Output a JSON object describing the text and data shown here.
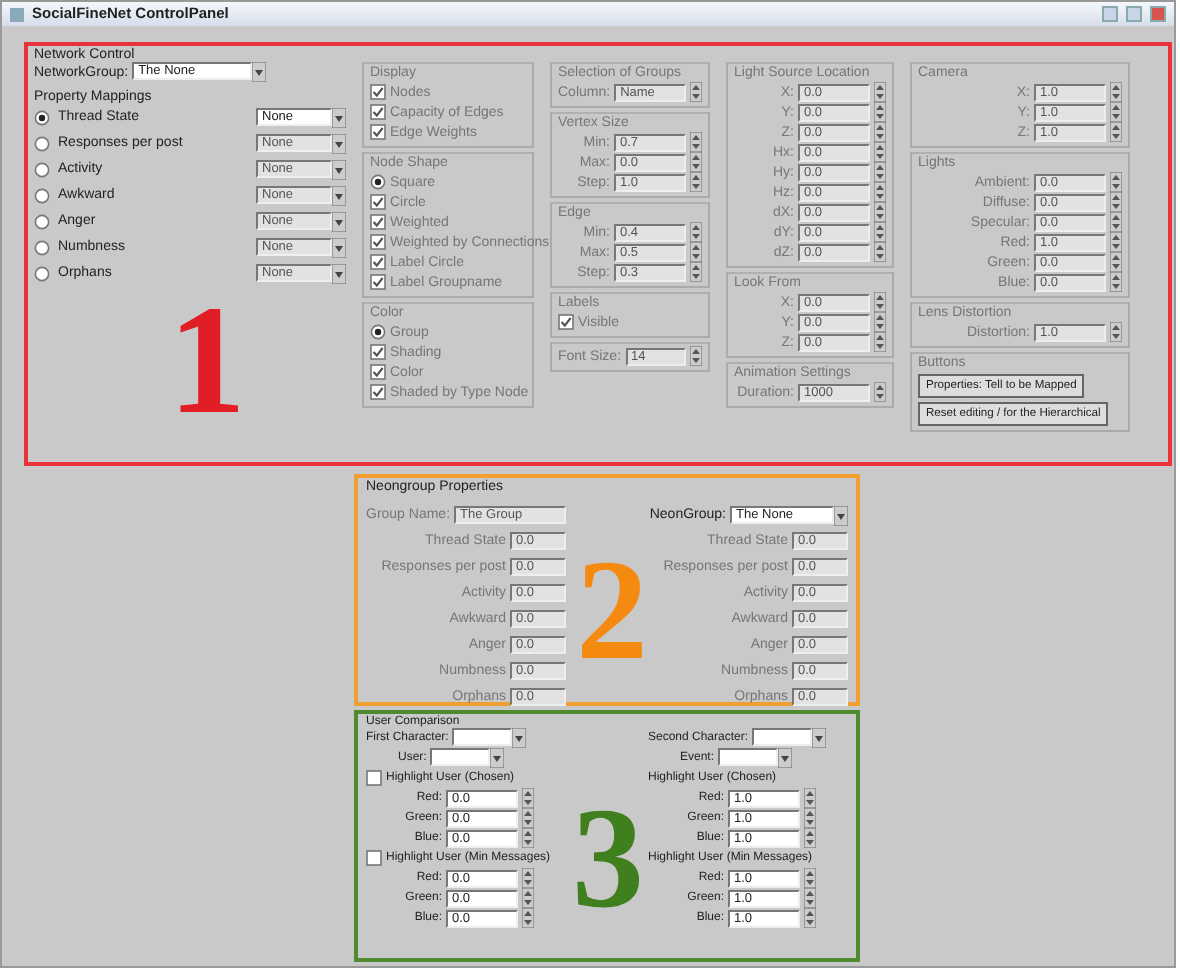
{
  "window": {
    "title": "SocialFineNet ControlPanel"
  },
  "network_control": {
    "title": "Network Control",
    "overlay_number": "1",
    "network_group": {
      "label": "NetworkGroup:",
      "value": "The None"
    },
    "property_mappings": {
      "title": "Property Mappings",
      "items": [
        {
          "label": "Thread State",
          "selected": true,
          "value": "None"
        },
        {
          "label": "Responses per post",
          "selected": false,
          "value": "None"
        },
        {
          "label": "Activity",
          "selected": false,
          "value": "None"
        },
        {
          "label": "Awkward",
          "selected": false,
          "value": "None"
        },
        {
          "label": "Anger",
          "selected": false,
          "value": "None"
        },
        {
          "label": "Numbness",
          "selected": false,
          "value": "None"
        },
        {
          "label": "Orphans",
          "selected": false,
          "value": "None"
        }
      ]
    },
    "columns": [
      [
        {
          "title": "Display",
          "kind": "options",
          "items": [
            {
              "kind": "check",
              "label": "Nodes",
              "checked": true
            },
            {
              "kind": "check",
              "label": "Capacity of Edges",
              "checked": true
            },
            {
              "kind": "check",
              "label": "Edge Weights",
              "checked": true
            }
          ]
        },
        {
          "title": "Node Shape",
          "kind": "options",
          "items": [
            {
              "kind": "radio",
              "label": "Square",
              "selected": true
            },
            {
              "kind": "check",
              "label": "Circle",
              "checked": true
            },
            {
              "kind": "check",
              "label": "Weighted",
              "checked": true
            },
            {
              "kind": "check",
              "label": "Weighted by Connections",
              "checked": true
            },
            {
              "kind": "check",
              "label": "Label Circle",
              "checked": true
            },
            {
              "kind": "check",
              "label": "Label Groupname",
              "checked": true
            }
          ]
        },
        {
          "title": "Color",
          "kind": "options",
          "items": [
            {
              "kind": "radio",
              "label": "Group",
              "selected": true
            },
            {
              "kind": "check",
              "label": "Shading",
              "checked": true
            },
            {
              "kind": "check",
              "label": "Color",
              "checked": true
            },
            {
              "kind": "check",
              "label": "Shaded by Type Node",
              "checked": true
            }
          ]
        }
      ],
      [
        {
          "title": "Selection of Groups",
          "kind": "fields",
          "items": [
            {
              "label": "Column:",
              "value": "Name"
            }
          ]
        },
        {
          "title": "Vertex Size",
          "kind": "fields",
          "items": [
            {
              "label": "Min:",
              "value": "0.7"
            },
            {
              "label": "Max:",
              "value": "0.0"
            },
            {
              "label": "Step:",
              "value": "1.0"
            }
          ]
        },
        {
          "title": "Edge",
          "kind": "fields",
          "items": [
            {
              "label": "Min:",
              "value": "0.4"
            },
            {
              "label": "Max:",
              "value": "0.5"
            },
            {
              "label": "Step:",
              "value": "0.3"
            }
          ]
        },
        {
          "title": "Labels",
          "kind": "options",
          "items": [
            {
              "kind": "check",
              "label": "Visible",
              "checked": true
            }
          ]
        },
        {
          "kind": "fields",
          "items": [
            {
              "label": "Font Size:",
              "value": "14"
            }
          ]
        }
      ],
      [
        {
          "title": "Light Source Location",
          "kind": "fields",
          "items": [
            {
              "label": "X:",
              "value": "0.0"
            },
            {
              "label": "Y:",
              "value": "0.0"
            },
            {
              "label": "Z:",
              "value": "0.0"
            },
            {
              "label": "Hx:",
              "value": "0.0"
            },
            {
              "label": "Hy:",
              "value": "0.0"
            },
            {
              "label": "Hz:",
              "value": "0.0"
            },
            {
              "label": "dX:",
              "value": "0.0"
            },
            {
              "label": "dY:",
              "value": "0.0"
            },
            {
              "label": "dZ:",
              "value": "0.0"
            }
          ]
        },
        {
          "title": "Look From",
          "kind": "fields",
          "items": [
            {
              "label": "X:",
              "value": "0.0"
            },
            {
              "label": "Y:",
              "value": "0.0"
            },
            {
              "label": "Z:",
              "value": "0.0"
            }
          ]
        },
        {
          "title": "Animation Settings",
          "kind": "fields",
          "items": [
            {
              "label": "Duration:",
              "value": "1000"
            }
          ]
        }
      ],
      [
        {
          "title": "Camera",
          "kind": "fields",
          "items": [
            {
              "label": "X:",
              "value": "1.0"
            },
            {
              "label": "Y:",
              "value": "1.0"
            },
            {
              "label": "Z:",
              "value": "1.0"
            }
          ]
        },
        {
          "title": "Lights",
          "kind": "fields",
          "items": [
            {
              "label": "Ambient:",
              "value": "0.0"
            },
            {
              "label": "Diffuse:",
              "value": "0.0"
            },
            {
              "label": "Specular:",
              "value": "0.0"
            },
            {
              "label": "Red:",
              "value": "1.0"
            },
            {
              "label": "Green:",
              "value": "0.0"
            },
            {
              "label": "Blue:",
              "value": "0.0"
            }
          ]
        },
        {
          "title": "Lens Distortion",
          "kind": "fields",
          "items": [
            {
              "label": "Distortion:",
              "value": "1.0"
            }
          ]
        },
        {
          "title": "Buttons",
          "kind": "buttons",
          "items": [
            {
              "label": "Properties: Tell to be Mapped"
            },
            {
              "label": "Reset editing / for the Hierarchical"
            }
          ]
        }
      ]
    ]
  },
  "neongroup_properties": {
    "title": "Neongroup Properties",
    "overlay_number": "2",
    "group_name": {
      "label": "Group Name:",
      "value": "The Group"
    },
    "neongroup": {
      "label": "NeonGroup:",
      "value": "The None"
    },
    "left_rows": [
      {
        "label": "Thread State",
        "value": "0.0"
      },
      {
        "label": "Responses per post",
        "value": "0.0"
      },
      {
        "label": "Activity",
        "value": "0.0"
      },
      {
        "label": "Awkward",
        "value": "0.0"
      },
      {
        "label": "Anger",
        "value": "0.0"
      },
      {
        "label": "Numbness",
        "value": "0.0"
      },
      {
        "label": "Orphans",
        "value": "0.0"
      }
    ],
    "right_rows": [
      {
        "label": "Thread State",
        "value": "0.0"
      },
      {
        "label": "Responses per post",
        "value": "0.0"
      },
      {
        "label": "Activity",
        "value": "0.0"
      },
      {
        "label": "Awkward",
        "value": "0.0"
      },
      {
        "label": "Anger",
        "value": "0.0"
      },
      {
        "label": "Numbness",
        "value": "0.0"
      },
      {
        "label": "Orphans",
        "value": "0.0"
      }
    ]
  },
  "user_comparison": {
    "title": "User Comparison",
    "overlay_number": "3",
    "sides": [
      {
        "character_label": "First Character:",
        "user_label": "User:",
        "groups": [
          {
            "label": "Highlight User (Chosen)",
            "checked": false,
            "rows": [
              {
                "label": "Red:",
                "value": "0.0"
              },
              {
                "label": "Green:",
                "value": "0.0"
              },
              {
                "label": "Blue:",
                "value": "0.0"
              }
            ]
          },
          {
            "label": "Highlight User (Min Messages)",
            "checked": false,
            "rows": [
              {
                "label": "Red:",
                "value": "0.0"
              },
              {
                "label": "Green:",
                "value": "0.0"
              },
              {
                "label": "Blue:",
                "value": "0.0"
              }
            ]
          }
        ]
      },
      {
        "character_label": "Second Character:",
        "user_label": "Event:",
        "groups": [
          {
            "label": "Highlight User (Chosen)",
            "rows": [
              {
                "label": "Red:",
                "value": "1.0"
              },
              {
                "label": "Green:",
                "value": "1.0"
              },
              {
                "label": "Blue:",
                "value": "1.0"
              }
            ]
          },
          {
            "label": "Highlight User (Min Messages)",
            "rows": [
              {
                "label": "Red:",
                "value": "1.0"
              },
              {
                "label": "Green:",
                "value": "1.0"
              },
              {
                "label": "Blue:",
                "value": "1.0"
              }
            ]
          }
        ]
      }
    ]
  }
}
